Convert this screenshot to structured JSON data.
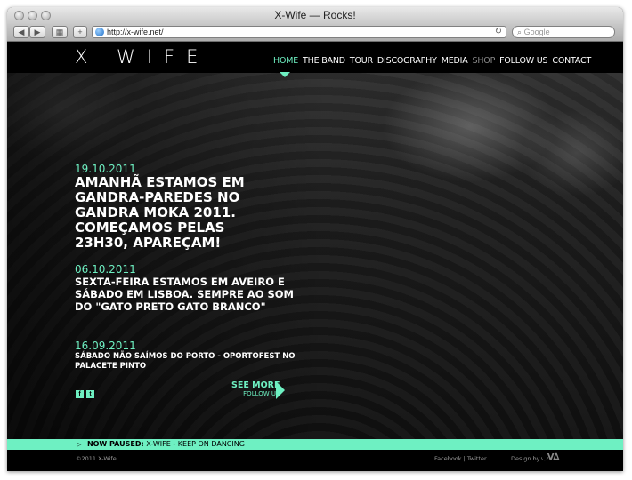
{
  "window": {
    "title": "X-Wife — Rocks!"
  },
  "toolbar": {
    "url": "http://x-wife.net/",
    "search_placeholder": "Google"
  },
  "site": {
    "logo": "X WIFE",
    "nav": [
      {
        "label": "HOME",
        "state": "active"
      },
      {
        "label": "THE BAND",
        "state": "normal"
      },
      {
        "label": "TOUR",
        "state": "normal"
      },
      {
        "label": "DISCOGRAPHY",
        "state": "normal"
      },
      {
        "label": "MEDIA",
        "state": "normal"
      },
      {
        "label": "SHOP",
        "state": "dimmed"
      },
      {
        "label": "FOLLOW US",
        "state": "normal"
      },
      {
        "label": "CONTACT",
        "state": "normal"
      }
    ]
  },
  "news": [
    {
      "date": "19.10.2011",
      "text": "AMANHÃ ESTAMOS EM GANDRA-PAREDES NO GANDRA MOKA 2011. COMEÇAMOS PELAS 23H30, APAREÇAM!"
    },
    {
      "date": "06.10.2011",
      "text": "SEXTA-FEIRA ESTAMOS EM AVEIRO E SÁBADO EM LISBOA. SEMPRE AO SOM DO \"GATO PRETO GATO BRANCO\""
    },
    {
      "date": "16.09.2011",
      "text": "SÁBADO NÃO SAÍMOS DO PORTO - OPORTOFEST NO PALACETE PINTO"
    }
  ],
  "social": {
    "facebook": "f",
    "twitter": "t"
  },
  "see_more": {
    "label": "SEE MORE",
    "sub": "FOLLOW US"
  },
  "player": {
    "label": "NOW PAUSED:",
    "track": "X-WIFE - KEEP ON DANCING"
  },
  "footer": {
    "copyright": "©2011 X-Wife",
    "links": "Facebook | Twitter",
    "design_by": "Design by"
  },
  "colors": {
    "accent": "#6ef0c2",
    "background": "#000000"
  }
}
